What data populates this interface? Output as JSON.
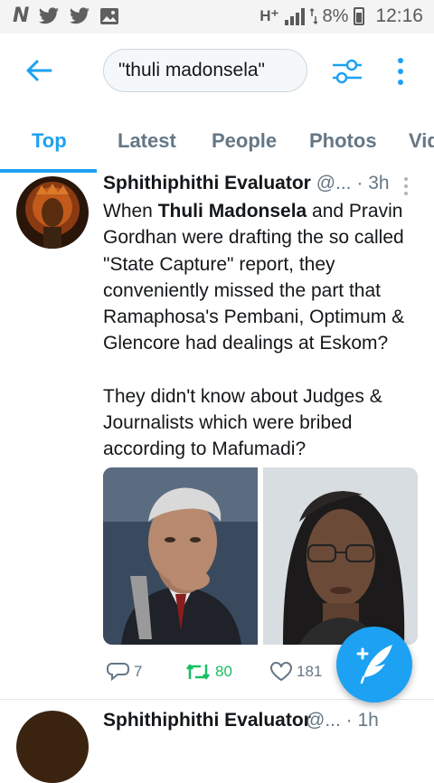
{
  "status_bar": {
    "left_icons": [
      "N",
      "twitter-bird-icon",
      "twitter-bird-icon",
      "image-icon"
    ],
    "network": "H⁺",
    "battery": "8%",
    "time": "12:16"
  },
  "header": {
    "search_query": "\"thuli madonsela\"",
    "icons": [
      "back-arrow-icon",
      "filter-sliders-icon",
      "more-vertical-icon"
    ]
  },
  "tabs": [
    {
      "label": "Top",
      "active": true
    },
    {
      "label": "Latest",
      "active": false
    },
    {
      "label": "People",
      "active": false
    },
    {
      "label": "Photos",
      "active": false
    },
    {
      "label": "Vid",
      "active": false
    }
  ],
  "tweet": {
    "name": "Sphithiphithi Evaluator",
    "handle": "@...",
    "separator": "·",
    "time": "3h",
    "body": {
      "p1_pre": "When ",
      "p1_bold": "Thuli Madonsela",
      "p1_post": " and Pravin Gordhan were drafting the so called \"State Capture\" report, they conveniently missed the part that Ramaphosa's Pembani, Optimum & Glencore had dealings at Eskom?",
      "p2": "They didn't know about Judges & Journalists which were bribed according to Mafumadi?"
    },
    "media": [
      "photo-man-hand-on-chin",
      "photo-woman-glasses"
    ],
    "replies": "7",
    "retweets": "80",
    "likes": "181"
  },
  "next_tweet": {
    "name": "Sphithiphithi Evaluator",
    "meta": "@... · 1h"
  },
  "colors": {
    "accent": "#1da1f2",
    "retweet": "#17bf63",
    "muted": "#657786"
  }
}
